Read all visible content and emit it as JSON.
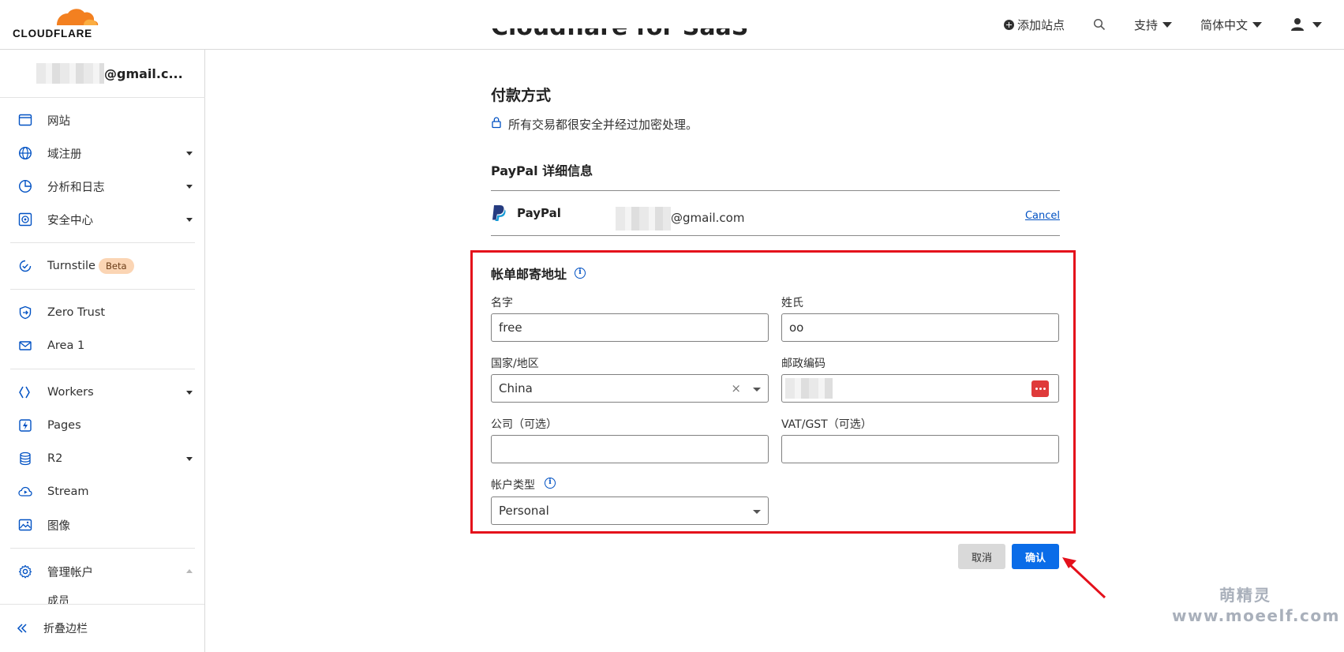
{
  "header": {
    "logo_text": "CLOUDFLARE",
    "add_site": "添加站点",
    "support": "支持",
    "language": "简体中文"
  },
  "sidebar": {
    "account_email_suffix": "@gmail.c...",
    "items": [
      {
        "label": "网站"
      },
      {
        "label": "域注册"
      },
      {
        "label": "分析和日志"
      },
      {
        "label": "安全中心"
      },
      {
        "label": "Turnstile",
        "badge": "Beta"
      },
      {
        "label": "Zero Trust"
      },
      {
        "label": "Area 1"
      },
      {
        "label": "Workers"
      },
      {
        "label": "Pages"
      },
      {
        "label": "R2"
      },
      {
        "label": "Stream"
      },
      {
        "label": "图像"
      },
      {
        "label": "管理帐户"
      }
    ],
    "sub_item": "成员",
    "collapse_label": "折叠边栏"
  },
  "main": {
    "cut_heading": "Cloudflare for SaaS",
    "payment_title": "付款方式",
    "secure_text": "所有交易都很安全并经过加密处理。",
    "paypal_title": "PayPal 详细信息",
    "paypal_name": "PayPal",
    "paypal_email_suffix": "@gmail.com",
    "cancel_link": "Cancel",
    "billing_title": "帐单邮寄地址",
    "fields": {
      "first_name_label": "名字",
      "first_name_value": "free",
      "last_name_label": "姓氏",
      "last_name_value": "oo",
      "country_label": "国家/地区",
      "country_value": "China",
      "postal_label": "邮政编码",
      "company_label": "公司（可选）",
      "vat_label": "VAT/GST（可选）",
      "account_type_label": "帐户类型",
      "account_type_value": "Personal"
    },
    "cancel_button": "取消",
    "confirm_button": "确认"
  },
  "watermark": {
    "cn": "萌精灵",
    "url": "www.moeelf.com"
  },
  "colors": {
    "accent_blue": "#0a6ce8",
    "link_blue": "#0051c3",
    "highlight_red": "#e4101b",
    "cloudflare_orange": "#f38020"
  }
}
